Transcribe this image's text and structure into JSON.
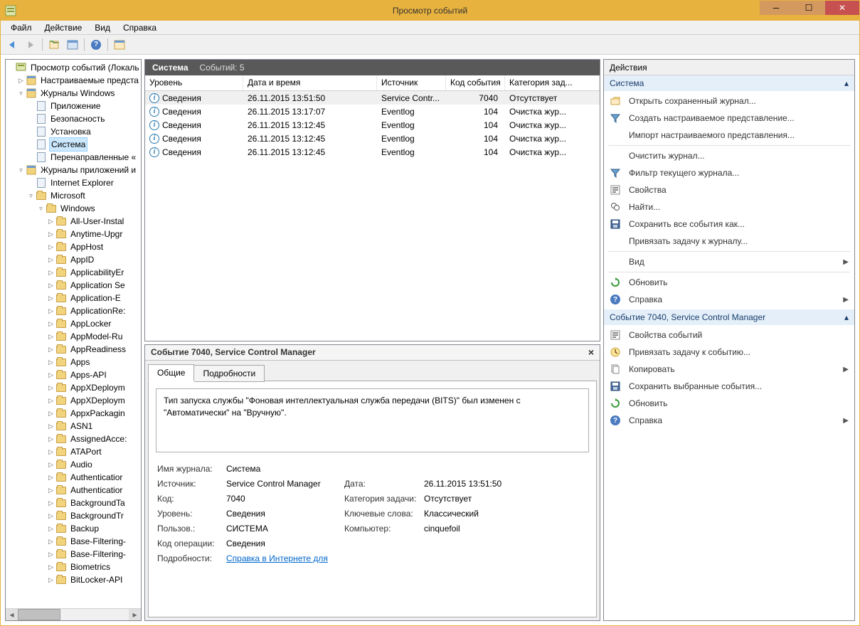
{
  "window": {
    "title": "Просмотр событий"
  },
  "menubar": [
    "Файл",
    "Действие",
    "Вид",
    "Справка"
  ],
  "center": {
    "header_main": "Система",
    "header_sub": "Событий: 5",
    "columns": [
      "Уровень",
      "Дата и время",
      "Источник",
      "Код события",
      "Категория зад..."
    ],
    "rows": [
      {
        "level": "Сведения",
        "dt": "26.11.2015 13:51:50",
        "src": "Service Contr...",
        "code": "7040",
        "cat": "Отсутствует",
        "sel": true
      },
      {
        "level": "Сведения",
        "dt": "26.11.2015 13:17:07",
        "src": "Eventlog",
        "code": "104",
        "cat": "Очистка жур..."
      },
      {
        "level": "Сведения",
        "dt": "26.11.2015 13:12:45",
        "src": "Eventlog",
        "code": "104",
        "cat": "Очистка жур..."
      },
      {
        "level": "Сведения",
        "dt": "26.11.2015 13:12:45",
        "src": "Eventlog",
        "code": "104",
        "cat": "Очистка жур..."
      },
      {
        "level": "Сведения",
        "dt": "26.11.2015 13:12:45",
        "src": "Eventlog",
        "code": "104",
        "cat": "Очистка жур..."
      }
    ]
  },
  "detail": {
    "pane_title": "Событие 7040, Service Control Manager",
    "tab_general": "Общие",
    "tab_details": "Подробности",
    "description": "Тип запуска службы \"Фоновая интеллектуальная служба передачи (BITS)\" был изменен с \"Автоматически\" на \"Вручную\".",
    "labels": {
      "log_name": "Имя журнала:",
      "source": "Источник:",
      "date": "Дата:",
      "code": "Код:",
      "task_cat": "Категория задачи:",
      "level": "Уровень:",
      "keywords": "Ключевые слова:",
      "user": "Пользов.:",
      "computer": "Компьютер:",
      "opcode": "Код операции:",
      "more": "Подробности:"
    },
    "values": {
      "log_name": "Система",
      "source": "Service Control Manager",
      "date": "26.11.2015 13:51:50",
      "code": "7040",
      "task_cat": "Отсутствует",
      "level": "Сведения",
      "keywords": "Классический",
      "user": "СИСТЕМА",
      "computer": "cinquefoil",
      "opcode": "Сведения",
      "more_link": "Справка в Интернете для "
    }
  },
  "actions": {
    "header": "Действия",
    "section1_title": "Система",
    "section1_items": [
      {
        "t": "Открыть сохраненный журнал...",
        "i": "open"
      },
      {
        "t": "Создать настраиваемое представление...",
        "i": "filter"
      },
      {
        "t": "Импорт настраиваемого представления...",
        "i": ""
      },
      {
        "sep": true
      },
      {
        "t": "Очистить журнал...",
        "i": ""
      },
      {
        "t": "Фильтр текущего журнала...",
        "i": "filter"
      },
      {
        "t": "Свойства",
        "i": "prop"
      },
      {
        "t": "Найти...",
        "i": "find"
      },
      {
        "t": "Сохранить все события как...",
        "i": "save"
      },
      {
        "t": "Привязать задачу к журналу...",
        "i": ""
      },
      {
        "sep": true
      },
      {
        "t": "Вид",
        "i": "",
        "arrow": true
      },
      {
        "sep": true
      },
      {
        "t": "Обновить",
        "i": "refresh"
      },
      {
        "t": "Справка",
        "i": "help",
        "arrow": true
      }
    ],
    "section2_title": "Событие 7040, Service Control Manager",
    "section2_items": [
      {
        "t": "Свойства событий",
        "i": "prop"
      },
      {
        "t": "Привязать задачу к событию...",
        "i": "task"
      },
      {
        "t": "Копировать",
        "i": "copy",
        "arrow": true
      },
      {
        "t": "Сохранить выбранные события...",
        "i": "save"
      },
      {
        "t": "Обновить",
        "i": "refresh"
      },
      {
        "t": "Справка",
        "i": "help",
        "arrow": true
      }
    ]
  },
  "tree": {
    "root": "Просмотр событий (Локаль",
    "custom_views": "Настраиваемые предста",
    "win_logs": "Журналы Windows",
    "win_logs_items": [
      "Приложение",
      "Безопасность",
      "Установка",
      "Система",
      "Перенаправленные «"
    ],
    "app_logs": "Журналы приложений и",
    "ie": "Internet Explorer",
    "microsoft": "Microsoft",
    "windows": "Windows",
    "win_items": [
      "All-User-Instal",
      "Anytime-Upgr",
      "AppHost",
      "AppID",
      "ApplicabilityEr",
      "Application Se",
      "Application-E",
      "ApplicationRe:",
      "AppLocker",
      "AppModel-Ru",
      "AppReadiness",
      "Apps",
      "Apps-API",
      "AppXDeploym",
      "AppXDeploym",
      "AppxPackagin",
      "ASN1",
      "AssignedAcce:",
      "ATAPort",
      "Audio",
      "Authenticatior",
      "Authenticatior",
      "BackgroundTa",
      "BackgroundTr",
      "Backup",
      "Base-Filtering-",
      "Base-Filtering-",
      "Biometrics",
      "BitLocker-API"
    ]
  }
}
